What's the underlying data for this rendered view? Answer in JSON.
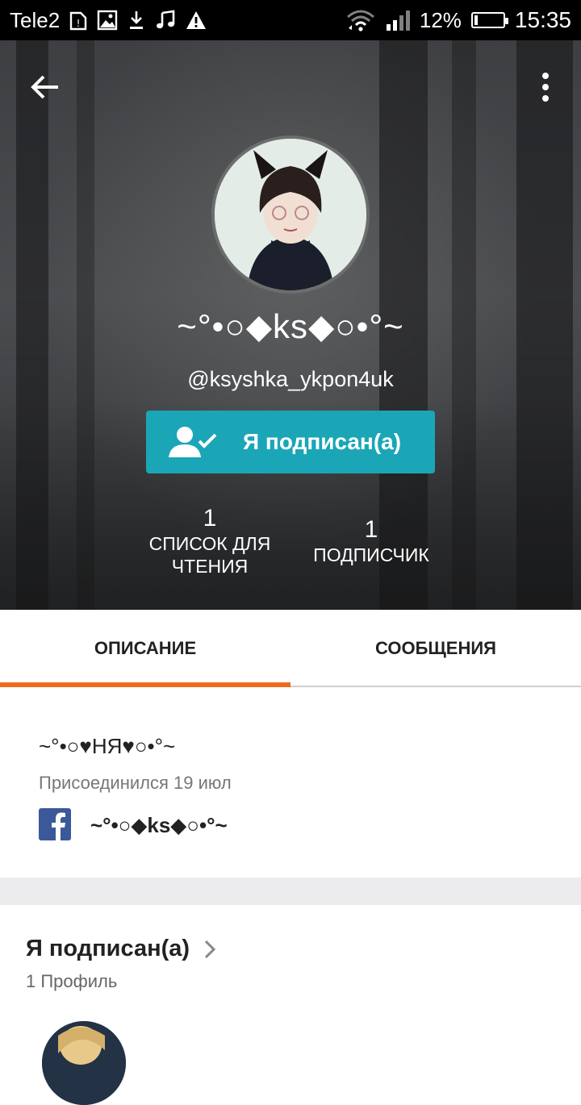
{
  "status_bar": {
    "carrier": "Tele2",
    "battery_percent": "12%",
    "time": "15:35",
    "left_icons": [
      "sim-alert-icon",
      "image-icon",
      "download-icon",
      "music-icon",
      "warning-icon"
    ],
    "right_icons": [
      "wifi-icon",
      "signal-icon",
      "battery-icon"
    ]
  },
  "header": {
    "back_icon": "arrow-left-icon",
    "menu_icon": "more-vertical-icon"
  },
  "profile": {
    "display_name": "~°•○◆ks◆○•°~",
    "username": "@ksyshka_ykpon4uk",
    "follow_button_label": "Я подписан(а)",
    "follow_button_icon": "user-check-icon",
    "follow_button_color": "#1aa6b7",
    "stats": {
      "reading_list": {
        "count": "1",
        "label_line1": "СПИСОК ДЛЯ",
        "label_line2": "ЧТЕНИЯ"
      },
      "followers": {
        "count": "1",
        "label": "ПОДПИСЧИК"
      }
    }
  },
  "tabs": {
    "items": [
      {
        "label": "ОПИСАНИЕ",
        "active": true
      },
      {
        "label": "СООБЩЕНИЯ",
        "active": false
      }
    ],
    "accent_color": "#ef6c1e"
  },
  "about": {
    "status_text": "~°•○♥НЯ♥○•°~",
    "joined_text": "Присоединился 19 июл",
    "facebook_icon": "facebook-icon",
    "facebook_name": "~°•○◆ks◆○•°~"
  },
  "following": {
    "title": "Я подписан(а)",
    "count_text": "1 Профиль",
    "chevron_icon": "chevron-right-icon"
  }
}
